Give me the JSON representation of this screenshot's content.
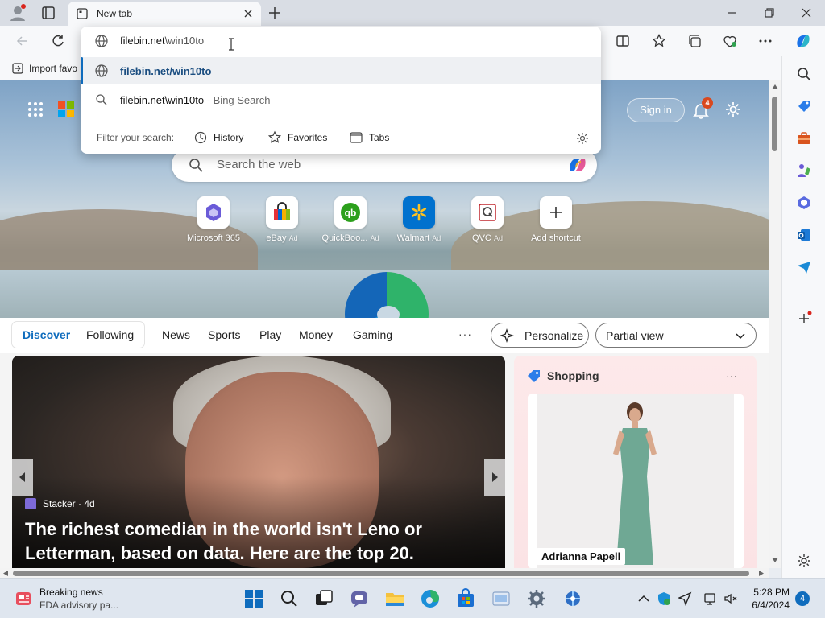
{
  "tab": {
    "title": "New tab"
  },
  "favbar": {
    "import_label": "Import favo"
  },
  "omnibox": {
    "typed": "filebin.net",
    "typed_rest": "\\win10to",
    "suggestions": [
      {
        "text": "filebin.net/win10to",
        "suffix": ""
      },
      {
        "text": "filebin.net\\win10to",
        "suffix": " - Bing Search"
      }
    ],
    "filter_label": "Filter your search:",
    "filters": [
      "History",
      "Favorites",
      "Tabs"
    ]
  },
  "hero": {
    "signin": "Sign in",
    "notif_count": "4",
    "search_placeholder": "Search the web",
    "shortcuts": [
      {
        "label": "Microsoft 365",
        "ad": ""
      },
      {
        "label": "eBay",
        "ad": "Ad"
      },
      {
        "label": "QuickBoo...",
        "ad": "Ad"
      },
      {
        "label": "Walmart",
        "ad": "Ad"
      },
      {
        "label": "QVC",
        "ad": "Ad"
      },
      {
        "label": "Add shortcut",
        "ad": ""
      }
    ]
  },
  "feednav": {
    "discover": "Discover",
    "following": "Following",
    "links": [
      "News",
      "Sports",
      "Play",
      "Money",
      "Gaming"
    ],
    "more": "···",
    "personalize": "Personalize",
    "view": "Partial view"
  },
  "feed": {
    "hero_card": {
      "source": "Stacker · 4d",
      "headline": "The richest comedian in the world isn't Leno or Letterman, based on data. Here are the top 20."
    },
    "shopping": {
      "title": "Shopping",
      "more": "···",
      "brand": "Adrianna Papell"
    }
  },
  "taskbar": {
    "news_title": "Breaking news",
    "news_sub": "FDA advisory pa...",
    "time": "5:28 PM",
    "date": "6/4/2024",
    "notif_count": "4"
  },
  "colors": {
    "accent": "#0f6cbd",
    "badge": "#d9491f"
  }
}
